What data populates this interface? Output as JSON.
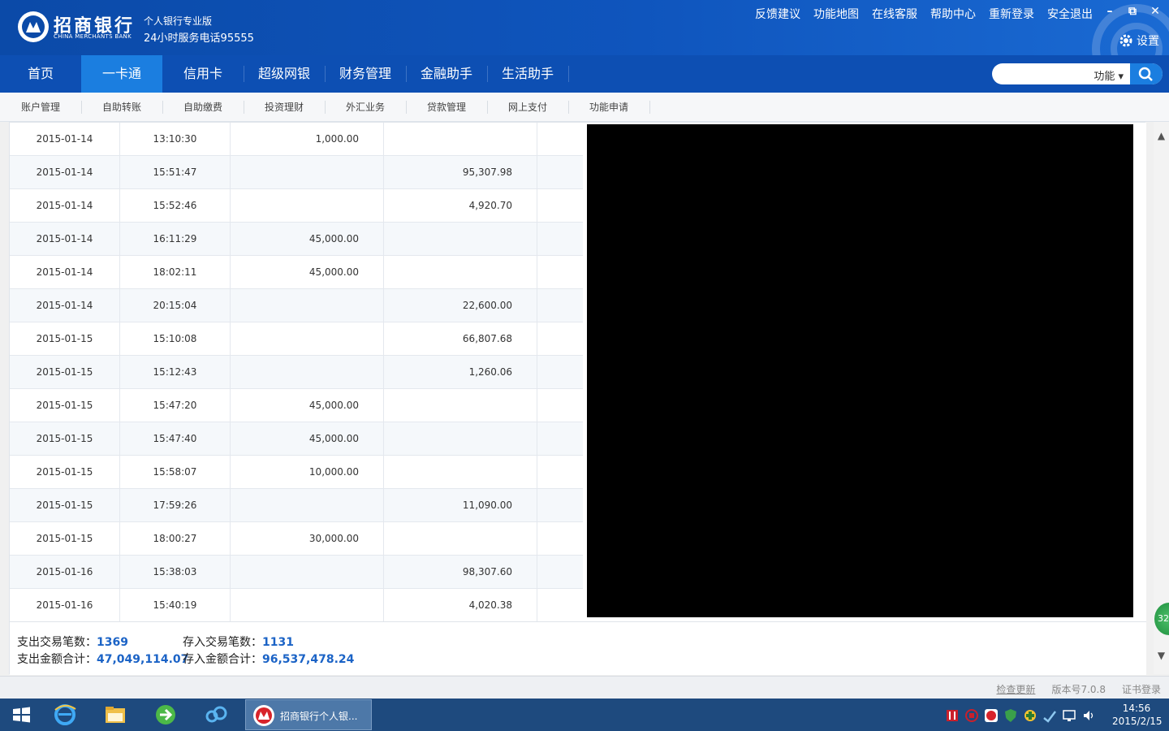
{
  "header": {
    "brand_cn": "招商银行",
    "brand_en": "CHINA MERCHANTS BANK",
    "subtitle": "个人银行专业版",
    "hotline": "24小时服务电话95555",
    "links": [
      "反馈建议",
      "功能地图",
      "在线客服",
      "帮助中心",
      "重新登录",
      "安全退出"
    ],
    "settings_label": "设置"
  },
  "window_controls": {
    "minimize": "–",
    "restore": "⧉",
    "close": "✕"
  },
  "main_nav": {
    "tabs": [
      "首页",
      "一卡通",
      "信用卡",
      "超级网银",
      "财务管理",
      "金融助手",
      "生活助手"
    ],
    "active_tab": "一卡通"
  },
  "search": {
    "function_label": "功能",
    "placeholder": ""
  },
  "sub_nav": {
    "items": [
      "账户管理",
      "自助转账",
      "自助缴费",
      "投资理财",
      "外汇业务",
      "贷款管理",
      "网上支付",
      "功能申请"
    ]
  },
  "transactions": [
    {
      "date": "2015-01-14",
      "time": "13:10:30",
      "out": "1,000.00",
      "in": ""
    },
    {
      "date": "2015-01-14",
      "time": "15:51:47",
      "out": "",
      "in": "95,307.98"
    },
    {
      "date": "2015-01-14",
      "time": "15:52:46",
      "out": "",
      "in": "4,920.70"
    },
    {
      "date": "2015-01-14",
      "time": "16:11:29",
      "out": "45,000.00",
      "in": ""
    },
    {
      "date": "2015-01-14",
      "time": "18:02:11",
      "out": "45,000.00",
      "in": ""
    },
    {
      "date": "2015-01-14",
      "time": "20:15:04",
      "out": "",
      "in": "22,600.00"
    },
    {
      "date": "2015-01-15",
      "time": "15:10:08",
      "out": "",
      "in": "66,807.68"
    },
    {
      "date": "2015-01-15",
      "time": "15:12:43",
      "out": "",
      "in": "1,260.06"
    },
    {
      "date": "2015-01-15",
      "time": "15:47:20",
      "out": "45,000.00",
      "in": ""
    },
    {
      "date": "2015-01-15",
      "time": "15:47:40",
      "out": "45,000.00",
      "in": ""
    },
    {
      "date": "2015-01-15",
      "time": "15:58:07",
      "out": "10,000.00",
      "in": ""
    },
    {
      "date": "2015-01-15",
      "time": "17:59:26",
      "out": "",
      "in": "11,090.00"
    },
    {
      "date": "2015-01-15",
      "time": "18:00:27",
      "out": "30,000.00",
      "in": ""
    },
    {
      "date": "2015-01-16",
      "time": "15:38:03",
      "out": "",
      "in": "98,307.60"
    },
    {
      "date": "2015-01-16",
      "time": "15:40:19",
      "out": "",
      "in": "4,020.38"
    }
  ],
  "summary": {
    "out_count_label": "支出交易笔数：",
    "out_count": "1369",
    "in_count_label": "存入交易笔数：",
    "in_count": "1131",
    "out_total_label": "支出金额合计：",
    "out_total": "47,049,114.07",
    "in_total_label": "存入金额合计：",
    "in_total": "96,537,478.24"
  },
  "floating_badge": "32",
  "statusbar": {
    "check_update": "检查更新",
    "version": "版本号7.0.8",
    "cert_login": "证书登录"
  },
  "taskbar": {
    "active_app_label": "招商银行个人银...",
    "time": "14:56",
    "date": "2015/2/15"
  },
  "colors": {
    "header_blue": "#0b4aa8",
    "nav_blue": "#0d4fb3",
    "active_tab": "#1b7ee0",
    "summary_value": "#1b63c6"
  }
}
